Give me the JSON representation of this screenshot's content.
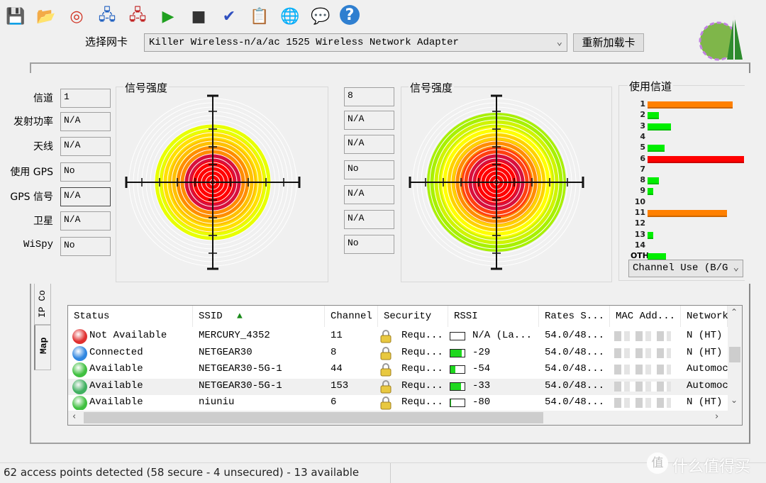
{
  "toolbar": {
    "icons": [
      "save-icon",
      "open-folder-icon",
      "target-icon",
      "connect-icon",
      "disconnect-icon",
      "start-log-icon",
      "stop-log-icon",
      "log-settings-icon",
      "checklist-icon",
      "globe-icon",
      "info-balloon-icon",
      "help-icon"
    ]
  },
  "adapter": {
    "label": "选择网卡",
    "value": "Killer Wireless-n/a/ac 1525 Wireless Network Adapter",
    "reload": "重新加载卡"
  },
  "left_fields": [
    {
      "label": "信道",
      "value": "1"
    },
    {
      "label": "发射功率",
      "value": "N/A"
    },
    {
      "label": "天线",
      "value": "N/A"
    },
    {
      "label": "使用 GPS",
      "value": "No"
    },
    {
      "label": "GPS 信号",
      "value": "N/A"
    },
    {
      "label": "卫星",
      "value": "N/A"
    },
    {
      "label": "WiSpy",
      "value": "No"
    }
  ],
  "mid_fields": [
    "8",
    "N/A",
    "N/A",
    "No",
    "N/A",
    "N/A",
    "No"
  ],
  "signal1": {
    "title": "信号强度",
    "rings": [
      "#e8ff00",
      "#ffe000",
      "#ffc000",
      "#ff8c00",
      "#d8103c",
      "#ff0000"
    ]
  },
  "signal2": {
    "title": "信号强度",
    "rings": [
      "#a8f000",
      "#d0f400",
      "#ffff00",
      "#ffd000",
      "#ff8c00",
      "#ff4010",
      "#d8103c",
      "#ff0000"
    ]
  },
  "channels": {
    "title": "使用信道",
    "select": "Channel Use (B/G",
    "items": [
      {
        "ch": "1",
        "usage": 88,
        "color": "#ff8000"
      },
      {
        "ch": "2",
        "usage": 12,
        "color": "#00ee00"
      },
      {
        "ch": "3",
        "usage": 24,
        "color": "#00ee00"
      },
      {
        "ch": "4",
        "usage": 0,
        "color": "#00ee00"
      },
      {
        "ch": "5",
        "usage": 18,
        "color": "#00ee00"
      },
      {
        "ch": "6",
        "usage": 100,
        "color": "#ff0000"
      },
      {
        "ch": "7",
        "usage": 0,
        "color": "#00ee00"
      },
      {
        "ch": "8",
        "usage": 12,
        "color": "#00ee00"
      },
      {
        "ch": "9",
        "usage": 6,
        "color": "#00ee00"
      },
      {
        "ch": "10",
        "usage": 0,
        "color": "#00ee00"
      },
      {
        "ch": "11",
        "usage": 82,
        "color": "#ff8000"
      },
      {
        "ch": "12",
        "usage": 0,
        "color": "#00ee00"
      },
      {
        "ch": "13",
        "usage": 6,
        "color": "#00ee00"
      },
      {
        "ch": "14",
        "usage": 0,
        "color": "#00ee00"
      },
      {
        "ch": "OTH",
        "usage": 19,
        "color": "#00ee00"
      }
    ]
  },
  "side_tabs": [
    "IP Co",
    "Map"
  ],
  "table": {
    "columns": [
      "Status",
      "SSID",
      "Channel",
      "Security",
      "RSSI",
      "Rates S...",
      "MAC Add...",
      "Network"
    ],
    "rows": [
      {
        "status": "Not Available",
        "color": "#e03030",
        "ssid": "MERCURY_4352",
        "channel": "11",
        "security": "Requ...",
        "rssi": "N/A (La...",
        "level": 0,
        "rates": "54.0/48...",
        "network": "N (HT)"
      },
      {
        "status": "Connected",
        "color": "#2f86e0",
        "ssid": "NETGEAR30",
        "channel": "8",
        "security": "Requ...",
        "rssi": "-29",
        "level": 80,
        "rates": "54.0/48...",
        "network": "N (HT)"
      },
      {
        "status": "Available",
        "color": "#40c040",
        "ssid": "NETGEAR30-5G-1",
        "channel": "44",
        "security": "Requ...",
        "rssi": "-54",
        "level": 35,
        "rates": "54.0/48...",
        "network": "Automoc"
      },
      {
        "status": "Available",
        "color": "#40b060",
        "ssid": "NETGEAR30-5G-1",
        "channel": "153",
        "security": "Requ...",
        "rssi": "-33",
        "level": 75,
        "rates": "54.0/48...",
        "network": "Automoc"
      },
      {
        "status": "Available",
        "color": "#40c040",
        "ssid": "niuniu",
        "channel": "6",
        "security": "Requ...",
        "rssi": "-80",
        "level": 5,
        "rates": "54.0/48...",
        "network": "N (HT)"
      }
    ]
  },
  "status_bar": "62 access points detected (58 secure - 4 unsecured) - 13 available",
  "watermark": "什么值得买",
  "watermark_badge": "值"
}
